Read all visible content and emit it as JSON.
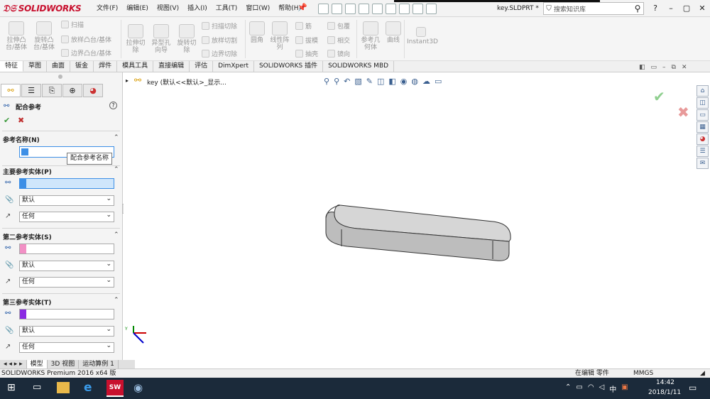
{
  "app": {
    "logo_text": "SOLIDWORKS",
    "menus": [
      "文件(F)",
      "编辑(E)",
      "视图(V)",
      "插入(I)",
      "工具(T)",
      "窗口(W)",
      "帮助(H)"
    ],
    "doc_name": "key.SLDPRT *",
    "search_placeholder": "搜索知识库"
  },
  "ribbon": {
    "big_buttons": [
      {
        "label": "拉伸凸\n台/基体"
      },
      {
        "label": "旋转凸\n台/基体"
      },
      {
        "label": "拉伸切\n除"
      },
      {
        "label": "异型孔\n向导"
      },
      {
        "label": "旋转切\n除"
      },
      {
        "label": "圆角"
      },
      {
        "label": "线性阵\n列"
      },
      {
        "label": "参考几\n何体"
      },
      {
        "label": "曲线"
      },
      {
        "label": "Instant3D"
      }
    ],
    "small_left": [
      "扫描",
      "放样凸台/基体",
      "边界凸台/基体"
    ],
    "small_cut": [
      "扫描切除",
      "放样切割",
      "边界切除"
    ],
    "small_mid": [
      "筋",
      "拔模",
      "抽壳"
    ],
    "small_wrap": [
      "包覆",
      "相交",
      "镜向"
    ]
  },
  "tabs": [
    "特征",
    "草图",
    "曲面",
    "钣金",
    "焊件",
    "模具工具",
    "直接编辑",
    "评估",
    "DimXpert",
    "SOLIDWORKS 插件",
    "SOLIDWORKS MBD"
  ],
  "active_tab": 0,
  "panel": {
    "title": "配合参考",
    "ref_name_section": "参考名称(N)",
    "ref_name_value": "",
    "tooltip": "配合参考名称",
    "primary_section": "主要参考实体(P)",
    "secondary_section": "第二参考实体(S)",
    "tertiary_section": "第三参考实体(T)",
    "default_label": "默认",
    "any_label": "任何"
  },
  "tree": {
    "path_text": "key  (默认<<默认>_显示..."
  },
  "bottom_tabs": [
    "模型",
    "3D 视图",
    "运动算例 1"
  ],
  "status": {
    "left": "SOLIDWORKS Premium 2016 x64 版",
    "right": "在编辑 零件",
    "units": "MMGS"
  },
  "taskbar": {
    "time": "14:42",
    "date": "2018/1/11",
    "ime": "中"
  },
  "colors": {
    "brand": "#c8102e",
    "primary_swatch": "#3d8fe6",
    "secondary_swatch": "#f290c5",
    "tertiary_swatch": "#8a2be2",
    "ok": "#3c9a3c",
    "cancel": "#c03030"
  }
}
